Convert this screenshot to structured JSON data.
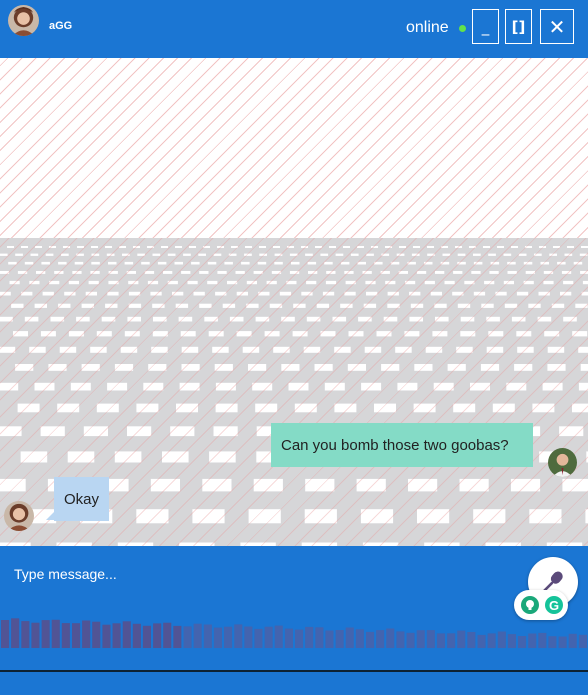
{
  "header": {
    "contact_name": "aGG",
    "status": "online",
    "status_color": "#62e24b",
    "avatar_icon": "avatar-icon",
    "window_buttons": {
      "minimize_label": "_",
      "maximize_label": "[]",
      "close_label": "✕"
    }
  },
  "conversation": {
    "messages": [
      {
        "direction": "sent",
        "text": "Can you bomb those two goobas?"
      },
      {
        "direction": "received",
        "text": "Okay"
      }
    ]
  },
  "composer": {
    "placeholder": "Type message...",
    "value": "",
    "mic_icon": "microphone-icon",
    "extension_icons": [
      "bulb-icon",
      "grammarly-icon"
    ],
    "extension_b_glyph": "G"
  },
  "colors": {
    "accent": "#1b76d3",
    "sent_bubble": "#84dbc6",
    "received_bubble": "#b9d6f2"
  }
}
